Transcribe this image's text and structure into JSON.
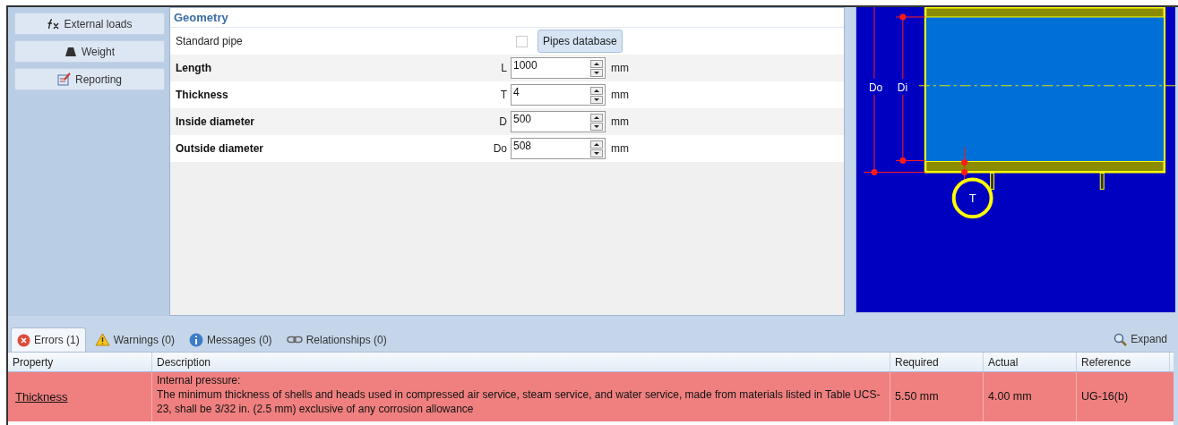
{
  "sidebar": {
    "buttons": [
      {
        "kind": "fx",
        "label": "External loads"
      },
      {
        "kind": "weight",
        "label": "Weight"
      },
      {
        "kind": "report",
        "label": "Reporting"
      }
    ]
  },
  "form": {
    "title": "Geometry",
    "rows": [
      {
        "kind": "checkbox",
        "label": "Standard pipe",
        "checked": false,
        "button": "Pipes database"
      },
      {
        "kind": "number",
        "label": "Length",
        "symbol": "L",
        "value": "1000",
        "unit": "mm"
      },
      {
        "kind": "number",
        "label": "Thickness",
        "symbol": "T",
        "value": "4",
        "unit": "mm"
      },
      {
        "kind": "number",
        "label": "Inside diameter",
        "symbol": "D",
        "value": "500",
        "unit": "mm"
      },
      {
        "kind": "number",
        "label": "Outside diameter",
        "symbol": "Do",
        "value": "508",
        "unit": "mm"
      }
    ]
  },
  "diagram": {
    "labels": [
      "Do",
      "Di"
    ],
    "marker": "T"
  },
  "issues": {
    "tabs": [
      {
        "kind": "error",
        "label": "Errors (1)",
        "selected": true
      },
      {
        "kind": "warning",
        "label": "Warnings (0)",
        "selected": false
      },
      {
        "kind": "info",
        "label": "Messages (0)",
        "selected": false
      },
      {
        "kind": "link",
        "label": "Relationships (0)",
        "selected": false
      }
    ],
    "expand": "Expand",
    "columns": [
      "Property",
      "Description",
      "Required",
      "Actual",
      "Reference"
    ],
    "rows": [
      {
        "property": "Thickness",
        "description": "Internal pressure:\nThe minimum thickness of shells and heads used in compressed air service, steam service, and water service, made from materials listed in Table UCS-23, shall be 3/32 in. (2.5 mm) exclusive of any corrosion allowance",
        "required": "5.50 mm",
        "actual": "4.00 mm",
        "reference": "UG-16(b)"
      }
    ]
  }
}
